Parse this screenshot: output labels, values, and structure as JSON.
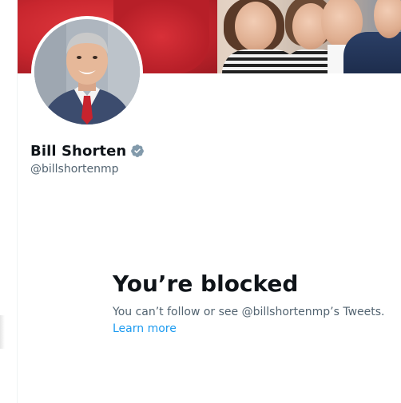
{
  "profile": {
    "name": "Bill Shorten",
    "handle": "@billshortenmp",
    "verified": true,
    "verified_badge_icon": "verified-badge-icon",
    "verified_badge_color": "#829aab",
    "banner_image": "group-photo-banner",
    "avatar_image": "profile-photo"
  },
  "blocked": {
    "title": "You’re blocked",
    "message": "You can’t follow or see @billshortenmp’s Tweets.",
    "learn_more_label": "Learn more",
    "link_color": "#1d9bf0"
  }
}
